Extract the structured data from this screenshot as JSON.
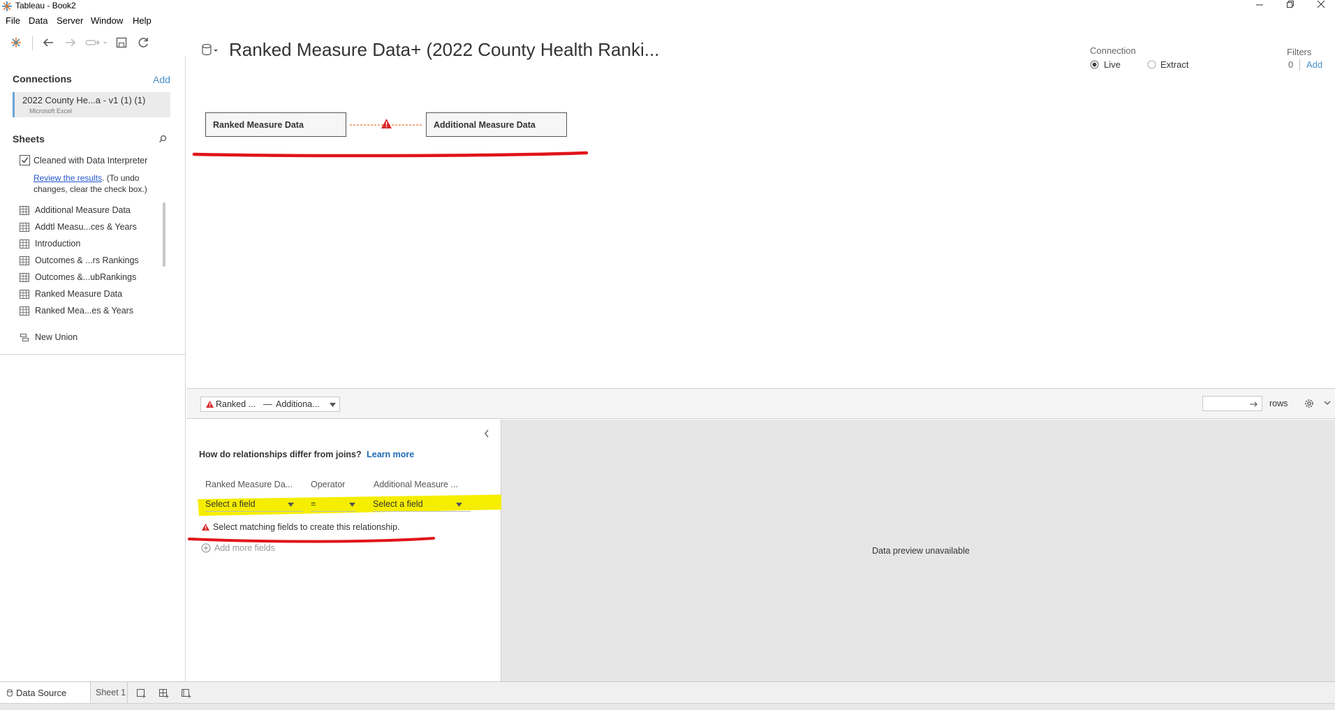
{
  "window": {
    "title": "Tableau - Book2",
    "controls": [
      "minimize",
      "restore",
      "close"
    ]
  },
  "menu": [
    "File",
    "Data",
    "Server",
    "Window",
    "Help"
  ],
  "left_pane": {
    "connections_title": "Connections",
    "connections_add": "Add",
    "connection": {
      "name": "2022 County He...a - v1 (1) (1)",
      "type": "Microsoft Excel"
    },
    "sheets_title": "Sheets",
    "data_interpreter": {
      "checked": true,
      "label": "Cleaned with Data Interpreter",
      "review_link": "Review the results",
      "review_rest_1": ". (To undo",
      "review_rest_2": "changes, clear the check box.)"
    },
    "sheets": [
      "Additional Measure Data",
      "Addtl Measu...ces & Years",
      "Introduction",
      "Outcomes & ...rs Rankings",
      "Outcomes &...ubRankings",
      "Ranked Measure Data",
      "Ranked Mea...es & Years"
    ],
    "new_union": "New Union"
  },
  "header": {
    "datasource_title": "Ranked Measure Data+ (2022 County Health Ranki...",
    "connection_label": "Connection",
    "connection_live": "Live",
    "connection_extract": "Extract",
    "connection_selected": "Live",
    "filters_label": "Filters",
    "filters_count": "0",
    "filters_add": "Add"
  },
  "canvas": {
    "left_table": "Ranked Measure Data",
    "right_table": "Additional Measure Data"
  },
  "relationship_bar": {
    "selector_left": "Ranked ...",
    "selector_dash": "—",
    "selector_right": "Additiona...",
    "rows_label": "rows"
  },
  "relationship_panel": {
    "question": "How do relationships differ from joins?",
    "learn_more": "Learn more",
    "col_left": "Ranked Measure Da...",
    "col_operator": "Operator",
    "col_right": "Additional Measure ...",
    "left_field": "Select a field",
    "operator": "=",
    "right_field": "Select a field",
    "warning": "Select matching fields to create this relationship.",
    "add_more": "Add more fields"
  },
  "preview": {
    "message": "Data preview unavailable"
  },
  "status_bar": {
    "tabs": [
      "Data Source",
      "Sheet 1"
    ],
    "active_tab": "Data Source"
  },
  "colors": {
    "accent_link": "#4a90c8",
    "warning_red": "#d9262b",
    "annotation_red": "#e0141a",
    "highlight_yellow": "#f5ee00"
  }
}
